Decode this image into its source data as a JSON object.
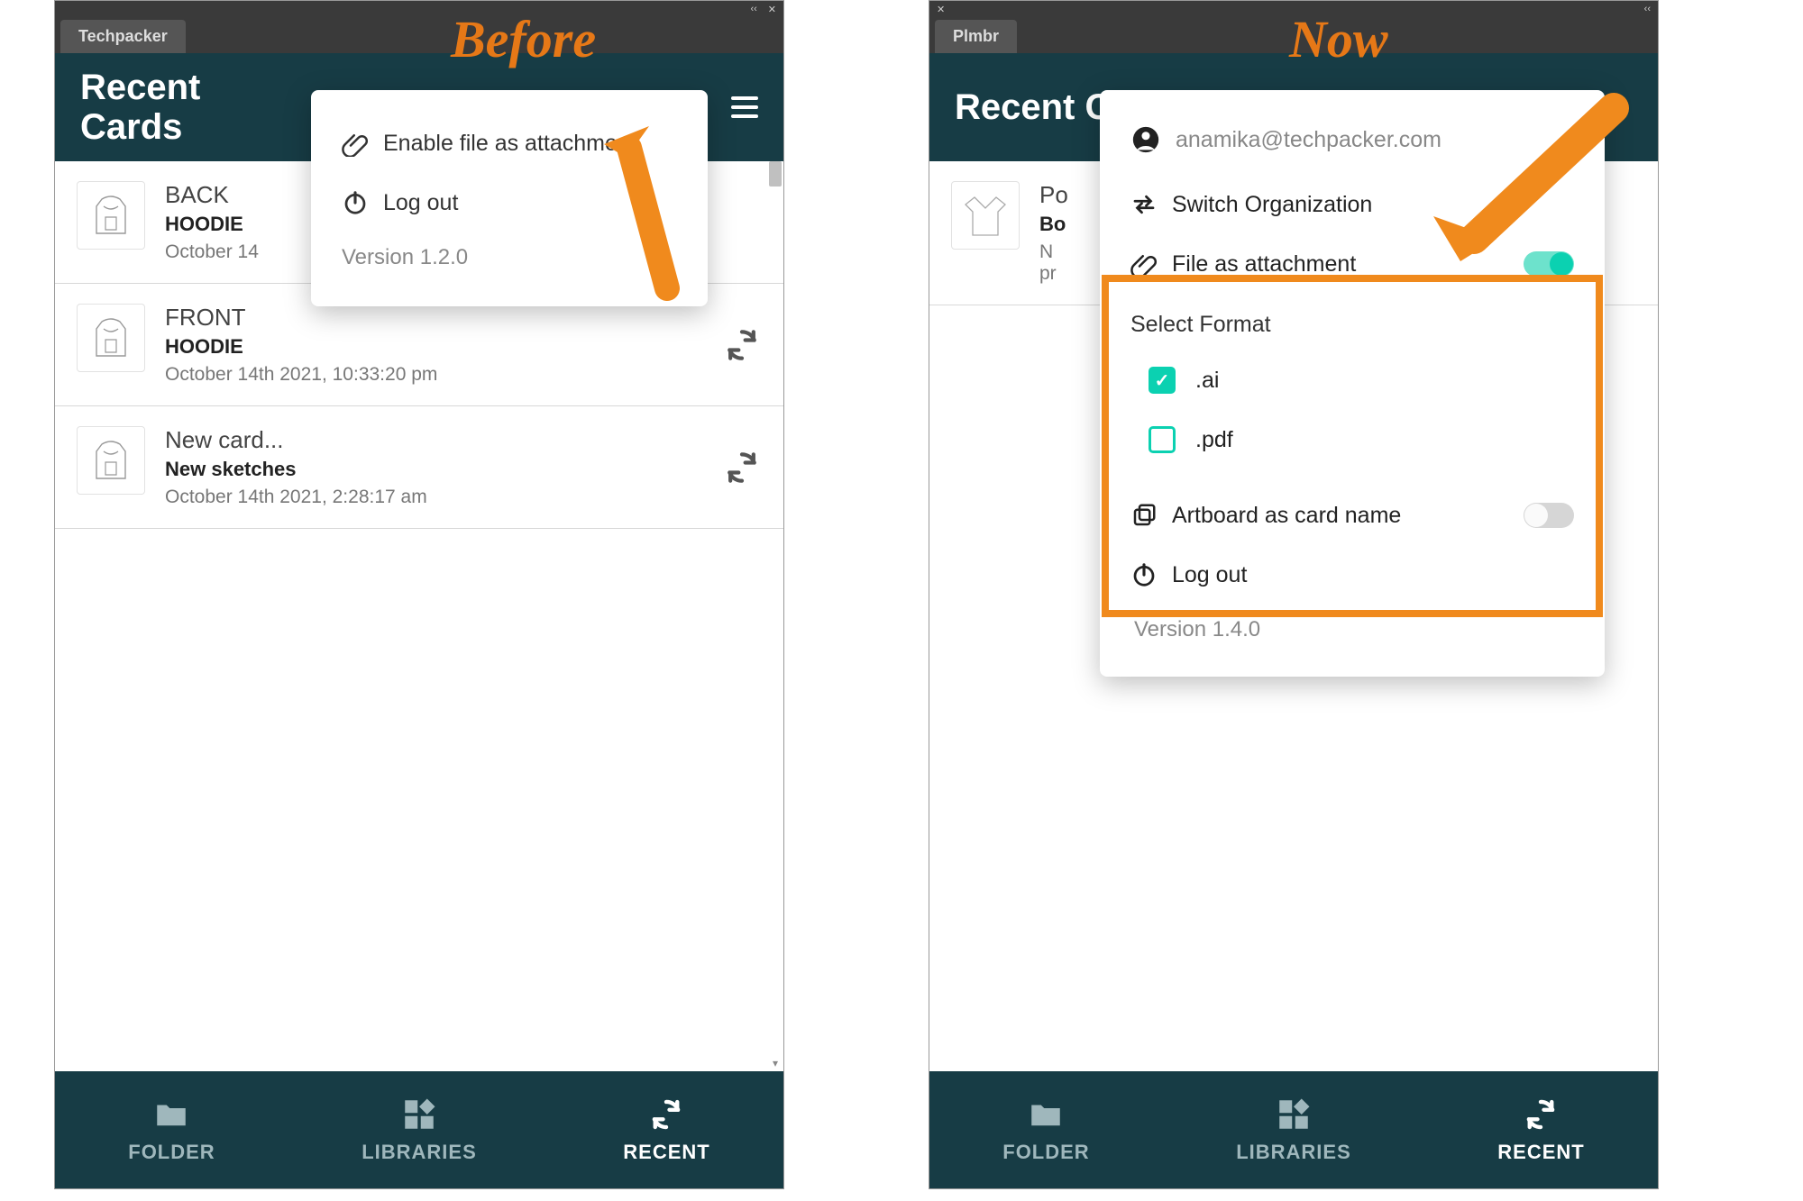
{
  "labels": {
    "before": "Before",
    "now": "Now"
  },
  "left": {
    "tab": "Techpacker",
    "header_title": "Recent\nCards",
    "popover": {
      "enable_attachment": "Enable file as attachment",
      "logout": "Log out",
      "version": "Version 1.2.0"
    },
    "cards": [
      {
        "name": "BACK",
        "sub": "HOODIE",
        "date": "October 14"
      },
      {
        "name": "FRONT",
        "sub": "HOODIE",
        "date": "October 14th 2021, 10:33:20 pm"
      },
      {
        "name": "New card...",
        "sub": "New sketches",
        "date": "October 14th 2021, 2:28:17 am"
      }
    ]
  },
  "right": {
    "tab": "Plmbr",
    "header_title": "Recent Ca",
    "partial_card": {
      "name": "Po",
      "sub": "Bo",
      "line3": "N",
      "line4": "pr"
    },
    "popover": {
      "email": "anamika@techpacker.com",
      "switch_org": "Switch Organization",
      "file_attachment": "File as attachment",
      "select_format": "Select Format",
      "format_ai": ".ai",
      "format_pdf": ".pdf",
      "artboard": "Artboard as card name",
      "logout": "Log out",
      "version": "Version 1.4.0"
    }
  },
  "nav": {
    "folder": "FOLDER",
    "libraries": "LIBRARIES",
    "recent": "RECENT"
  }
}
